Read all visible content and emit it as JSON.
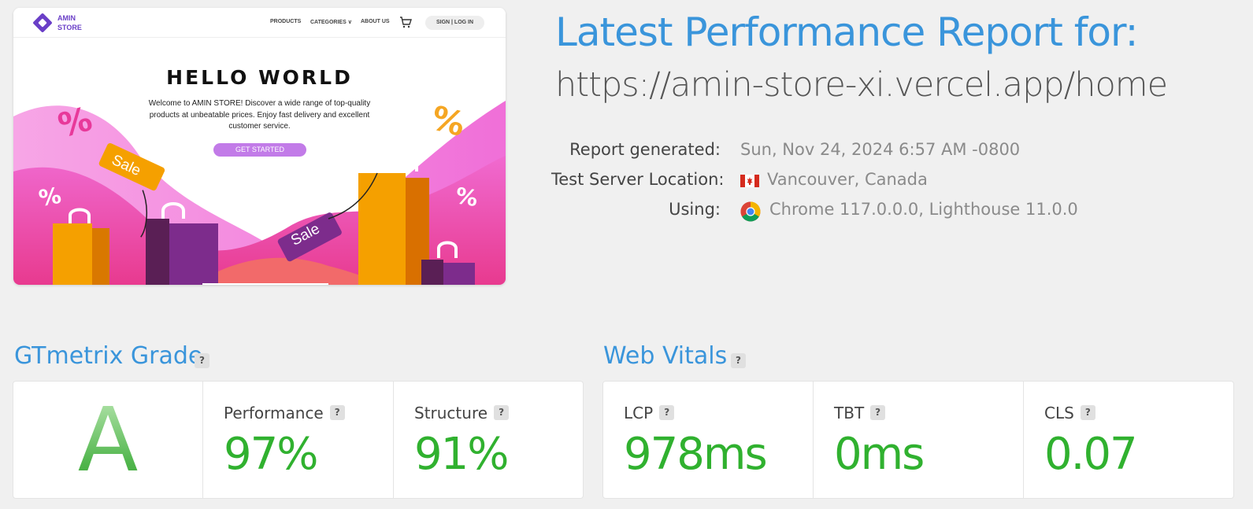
{
  "preview": {
    "logo_line1": "AMIN",
    "logo_line2": "STORE",
    "nav": [
      "PRODUCTS",
      "CATEGORIES ∨",
      "ABOUT US"
    ],
    "signin": "SIGN | LOG IN",
    "hero_title": "HELLO WORLD",
    "hero_desc": "Welcome to AMIN STORE! Discover a wide range of top-quality products at unbeatable prices. Enjoy fast delivery and excellent customer service.",
    "cta": "GET STARTED",
    "tag1": "Sale",
    "tag2": "Sale"
  },
  "report": {
    "title": "Latest Performance Report for:",
    "url": "https://amin-store-xi.vercel.app/home",
    "generated_label": "Report generated:",
    "generated_value": "Sun, Nov 24, 2024 6:57 AM -0800",
    "location_label": "Test Server Location:",
    "location_value": "Vancouver, Canada",
    "using_label": "Using:",
    "using_value": "Chrome 117.0.0.0, Lighthouse 11.0.0"
  },
  "grade_section": {
    "title": "GTmetrix Grade",
    "help": "?",
    "grade": "A",
    "performance_label": "Performance",
    "performance_value": "97%",
    "structure_label": "Structure",
    "structure_value": "91%"
  },
  "vitals_section": {
    "title": "Web Vitals",
    "help": "?",
    "lcp_label": "LCP",
    "lcp_value": "978ms",
    "tbt_label": "TBT",
    "tbt_value": "0ms",
    "cls_label": "CLS",
    "cls_value": "0.07"
  },
  "colors": {
    "accent": "#3a95db",
    "good": "#30b12f",
    "brand": "#6a3fc7"
  }
}
